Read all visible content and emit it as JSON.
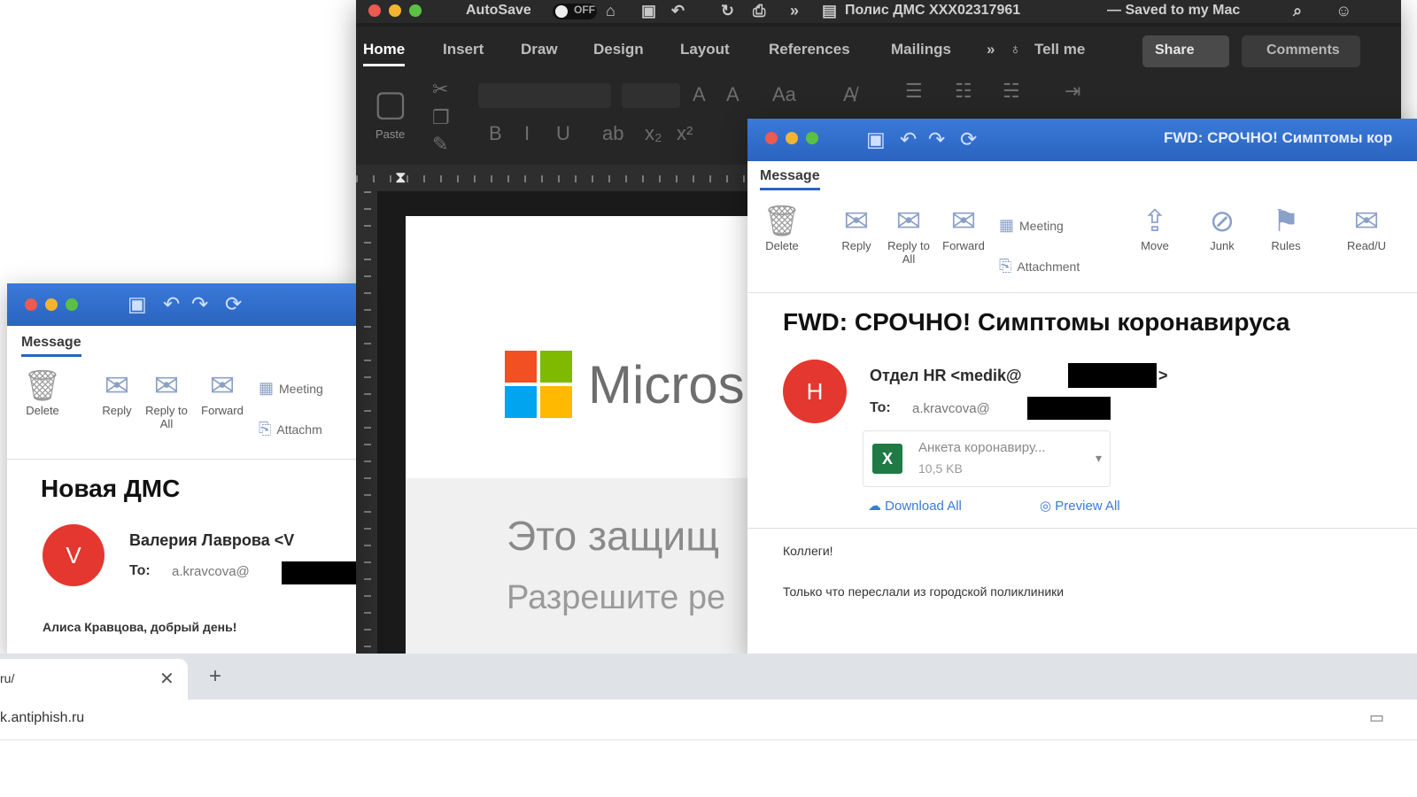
{
  "word": {
    "autosave_label": "AutoSave",
    "autosave_state": "OFF",
    "doc_title": "Полис ДМС XXX02317961",
    "saved_status": "— Saved to my Mac",
    "tabs": [
      "Home",
      "Insert",
      "Draw",
      "Design",
      "Layout",
      "References",
      "Mailings",
      "Tell me"
    ],
    "share_label": "Share",
    "comments_label": "Comments",
    "paste_label": "Paste",
    "document": {
      "brand_text": "Micros",
      "line1": "Это защищ",
      "line2": "Разрешите ре",
      "logo_colors": [
        "#f25022",
        "#7fba00",
        "#00a4ef",
        "#ffb900"
      ]
    }
  },
  "outlook_left": {
    "tab": "Message",
    "tools": {
      "delete": "Delete",
      "reply": "Reply",
      "reply_all": "Reply to All",
      "forward": "Forward",
      "meeting": "Meeting",
      "attachment": "Attachm"
    },
    "subject": "Новая ДМС",
    "avatar_letter": "V",
    "sender": "Валерия Лаврова <V",
    "to_label": "To:",
    "to_value": "a.kravcova@",
    "body_line": "Алиса Кравцова, добрый день!"
  },
  "outlook_right": {
    "title": "FWD: СРОЧНО! Симптомы кор",
    "tab": "Message",
    "tools": {
      "delete": "Delete",
      "reply": "Reply",
      "reply_all": "Reply to All",
      "forward": "Forward",
      "meeting": "Meeting",
      "attachment": "Attachment",
      "move": "Move",
      "junk": "Junk",
      "rules": "Rules",
      "read": "Read/U"
    },
    "subject": "FWD: СРОЧНО! Симптомы коронавируса",
    "avatar_letter": "H",
    "sender": "Отдел HR <medik@",
    "sender_end": ">",
    "to_label": "To:",
    "to_value": "a.kravcova@",
    "attachment": {
      "name": "Анкета коронавиру...",
      "size": "10,5 KB"
    },
    "download_all": "Download All",
    "preview_all": "Preview All",
    "body_greeting": "Коллеги!",
    "body_line": "Только что переслали из городской поликлиники"
  },
  "browser": {
    "tab_title": "ru/",
    "url": "k.antiphish.ru"
  },
  "colors": {
    "outlook_blue": "#2b63c0",
    "avatar_red": "#e3372f",
    "word_dark": "#1f1f1f"
  }
}
